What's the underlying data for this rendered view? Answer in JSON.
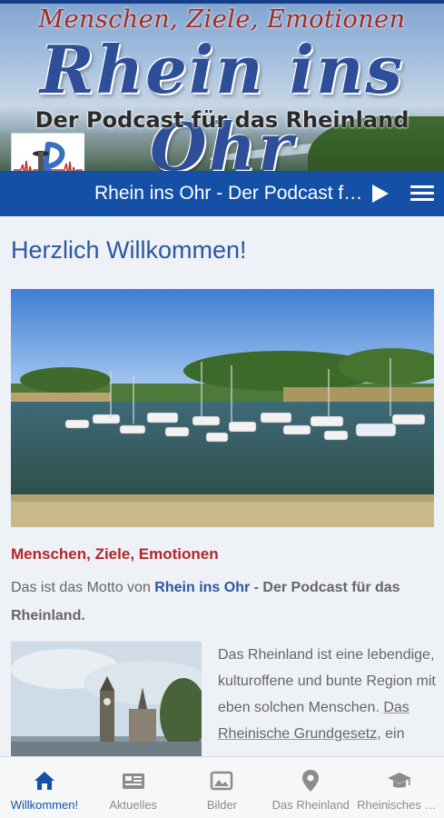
{
  "header": {
    "motto": "Menschen, Ziele, Emotionen",
    "brand": "Rhein ins Ohr",
    "subtitle": "Der Podcast für das Rheinland"
  },
  "navbar": {
    "title": "Rhein ins Ohr - Der Podcast für das Rheinland",
    "play_icon": "play-icon",
    "menu_icon": "hamburger-menu-icon"
  },
  "content": {
    "heading": "Herzlich Willkommen!",
    "motto": "Menschen, Ziele, Emotionen",
    "intro_prefix": "Das ist das Motto von ",
    "intro_link": "Rhein ins Ohr",
    "intro_suffix": " - Der Podcast für das Rheinland.",
    "para2_part1": "Das Rheinland ist eine lebendige, kulturoffene und bunte Region mit eben solchen Menschen. ",
    "para2_link": "Das Rheinische Grundgesetz",
    "para2_part2": ", ein"
  },
  "bottom_nav": {
    "items": [
      {
        "label": "Willkommen!",
        "icon": "home-icon",
        "active": true
      },
      {
        "label": "Aktuelles",
        "icon": "news-icon",
        "active": false
      },
      {
        "label": "Bilder",
        "icon": "image-icon",
        "active": false
      },
      {
        "label": "Das Rheinland",
        "icon": "location-pin-icon",
        "active": false
      },
      {
        "label": "Rheinisches Grundgesetz",
        "icon": "graduation-cap-icon",
        "active": false
      }
    ]
  },
  "colors": {
    "primary": "#1451a6",
    "heading": "#2b57a4",
    "accent_red": "#b3262b",
    "background": "#eef1f6"
  }
}
